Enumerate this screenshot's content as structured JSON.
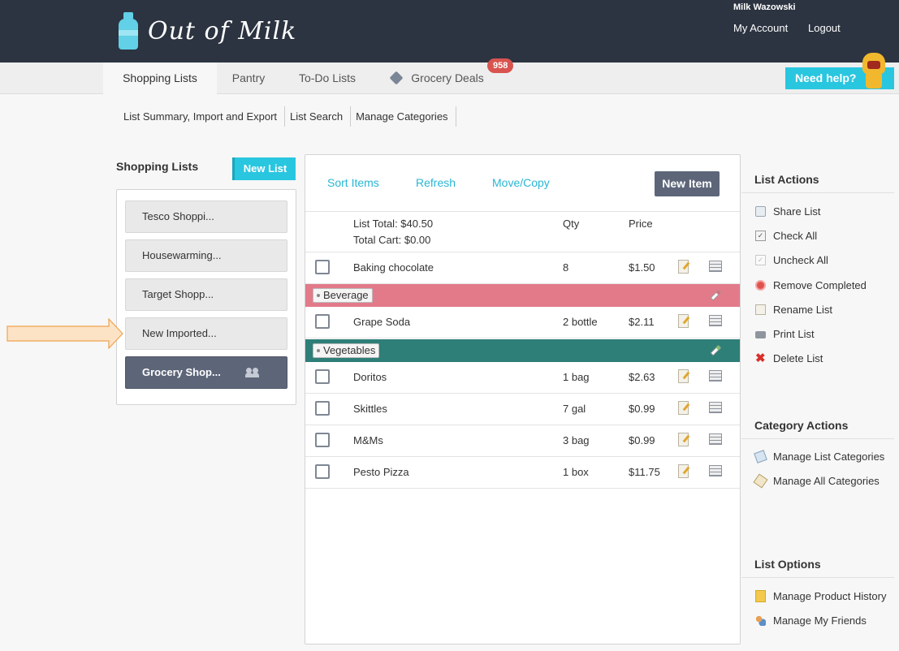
{
  "header": {
    "app_name": "Out of Milk",
    "user_name": "Milk Wazowski",
    "my_account": "My Account",
    "logout": "Logout"
  },
  "tabs": [
    {
      "label": "Shopping Lists",
      "active": true
    },
    {
      "label": "Pantry",
      "active": false
    },
    {
      "label": "To-Do Lists",
      "active": false
    },
    {
      "label": "Grocery Deals",
      "active": false,
      "icon": "tag-icon",
      "badge": "958"
    }
  ],
  "help": {
    "label": "Need help?"
  },
  "subnav": [
    "List Summary, Import and Export",
    "List Search",
    "Manage Categories"
  ],
  "sidebar": {
    "title": "Shopping Lists",
    "new_list_label": "New List",
    "lists": [
      {
        "label": "Tesco Shoppi...",
        "active": false
      },
      {
        "label": "Housewarming...",
        "active": false
      },
      {
        "label": "Target Shopp...",
        "active": false
      },
      {
        "label": "New Imported...",
        "active": false,
        "highlighted_by_arrow": true
      },
      {
        "label": "Grocery Shop...",
        "active": true,
        "shared": true
      }
    ]
  },
  "main": {
    "toolbar": {
      "sort": "Sort Items",
      "refresh": "Refresh",
      "move_copy": "Move/Copy",
      "new_item": "New Item"
    },
    "summary": {
      "list_total": "List Total: $40.50",
      "total_cart": "Total Cart: $0.00",
      "qty_header": "Qty",
      "price_header": "Price"
    },
    "uncategorized": [
      {
        "name": "Baking chocolate",
        "qty": "8",
        "price": "$1.50",
        "checked": false
      }
    ],
    "categories": [
      {
        "name": "Beverage",
        "color": "#e27a8a",
        "items": [
          {
            "name": "Grape Soda",
            "qty": "2 bottle",
            "price": "$2.11",
            "checked": false
          }
        ]
      },
      {
        "name": "Vegetables",
        "color": "#2e7f78",
        "items": [
          {
            "name": "Doritos",
            "qty": "1 bag",
            "price": "$2.63",
            "checked": false
          },
          {
            "name": "Skittles",
            "qty": "7 gal",
            "price": "$0.99",
            "checked": false
          },
          {
            "name": "M&Ms",
            "qty": "3 bag",
            "price": "$0.99",
            "checked": false
          },
          {
            "name": "Pesto Pizza",
            "qty": "1 box",
            "price": "$11.75",
            "checked": false
          }
        ]
      }
    ]
  },
  "right": {
    "list_actions_title": "List Actions",
    "list_actions": [
      {
        "label": "Share List",
        "icon": "share-icon"
      },
      {
        "label": "Check All",
        "icon": "check-all-icon"
      },
      {
        "label": "Uncheck All",
        "icon": "uncheck-all-icon"
      },
      {
        "label": "Remove Completed",
        "icon": "remove-icon"
      },
      {
        "label": "Rename List",
        "icon": "rename-icon"
      },
      {
        "label": "Print List",
        "icon": "print-icon"
      },
      {
        "label": "Delete List",
        "icon": "delete-icon"
      }
    ],
    "category_actions_title": "Category Actions",
    "category_actions": [
      {
        "label": "Manage List Categories",
        "icon": "list-categories-icon"
      },
      {
        "label": "Manage All Categories",
        "icon": "all-categories-icon"
      }
    ],
    "list_options_title": "List Options",
    "list_options": [
      {
        "label": "Manage Product History",
        "icon": "history-icon"
      },
      {
        "label": "Manage My Friends",
        "icon": "friends-icon"
      }
    ]
  }
}
